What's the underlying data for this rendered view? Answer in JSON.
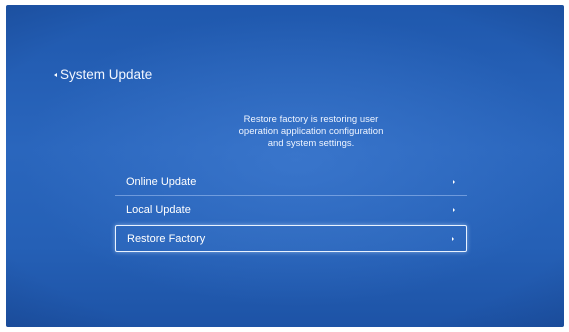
{
  "header": {
    "back_label": "System Update"
  },
  "description": {
    "lines": [
      "Restore factory is restoring user",
      "operation application configuration",
      "and system settings."
    ]
  },
  "menu": {
    "items": [
      {
        "label": "Online Update",
        "icon": "chevron-right-icon",
        "selected": false
      },
      {
        "label": "Local Update",
        "icon": "chevron-right-icon",
        "selected": false
      },
      {
        "label": "Restore Factory",
        "icon": "chevron-right-icon",
        "selected": true
      }
    ]
  },
  "colors": {
    "background": "#2a66bd",
    "text": "#ffffff",
    "selection_border": "#e8f2ff"
  }
}
